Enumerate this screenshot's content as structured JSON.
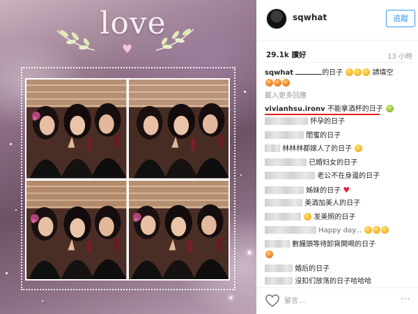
{
  "photo": {
    "overlay_text": "love"
  },
  "header": {
    "username": "sqwhat",
    "follow_label": "追蹤"
  },
  "stats": {
    "likes": "29.1k 讚好",
    "time": "13 小時"
  },
  "caption": {
    "username": "sqwhat",
    "text_after_blank": "的日子",
    "text_tail": "請填空"
  },
  "load_more": "載入更多回應",
  "comments": [
    {
      "username": "vivianhsu.ironv",
      "text": "不能拿酒杯的日子"
    },
    {
      "text": "怀孕的日子"
    },
    {
      "text": "閨蜜的日子"
    },
    {
      "text": "林林林都嫁人了的日子"
    },
    {
      "text": "已婚妇女的日子"
    },
    {
      "text": "老公不在身邊的日子"
    },
    {
      "text": "姊妹的日子"
    },
    {
      "text": "美酒加美人的日子"
    },
    {
      "text": "发美照的日子"
    },
    {
      "text": "Happy day..."
    },
    {
      "text": "數饅頭等待卸貨開喝的日子"
    },
    {
      "text": "婚后的日子"
    },
    {
      "text": "沒扣们放荡的日子哈哈哈"
    }
  ],
  "actions": {
    "comment_placeholder": "留言…",
    "more_label": "···"
  },
  "icons": {
    "like": "heart-outline-icon",
    "more": "ellipsis-icon"
  }
}
